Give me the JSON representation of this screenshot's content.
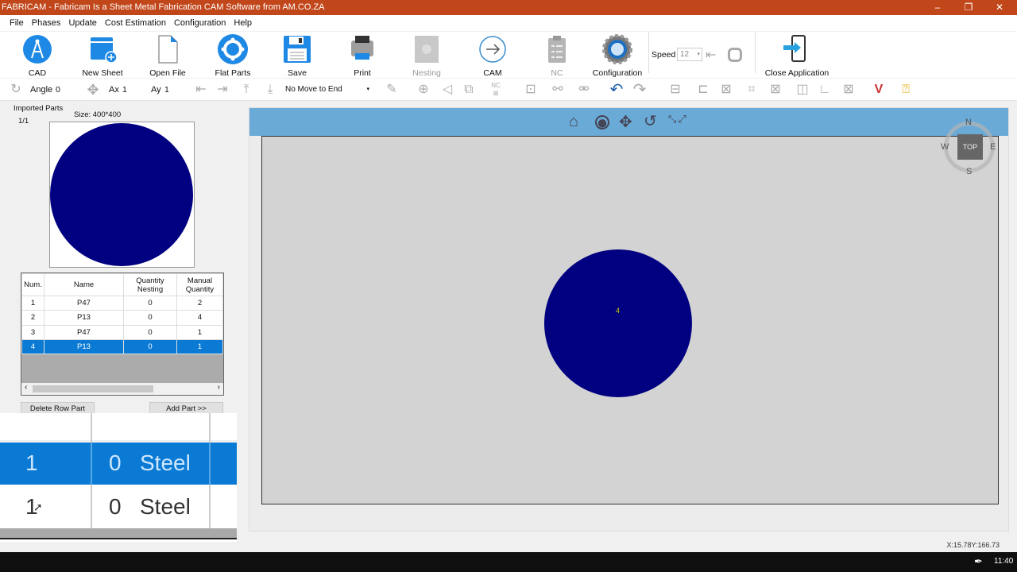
{
  "window": {
    "title": "FABRICAM - Fabricam Is a Sheet Metal Fabrication CAM Software from AM.CO.ZA",
    "minimize": "–",
    "restore": "❐",
    "close": "✕"
  },
  "menu": [
    "File",
    "Phases",
    "Update",
    "Cost Estimation",
    "Configuration",
    "Help"
  ],
  "toolbar": {
    "cad": "CAD",
    "new_sheet": "New Sheet",
    "open_file": "Open File",
    "flat_parts": "Flat Parts",
    "save": "Save",
    "print": "Print",
    "nesting": "Nesting",
    "cam": "CAM",
    "nc": "NC",
    "configuration": "Configuration",
    "speed_label": "Speed",
    "speed_value": "12",
    "close_app": "Close Application"
  },
  "toolbar2": {
    "angle_label": "Angle",
    "angle_value": "0",
    "ax_label": "Ax",
    "ax_value": "1",
    "ay_label": "Ay",
    "ay_value": "1",
    "move_select": "No Move to End",
    "nc_icon_text": "NC"
  },
  "imported_parts": {
    "title": "Imported Parts",
    "page": "1/1",
    "size": "Size: 400*400",
    "part_color": "#000080"
  },
  "parts_table": {
    "headers": [
      "Num.",
      "Name",
      "Quantity Nesting",
      "Manual Quantity"
    ],
    "rows": [
      [
        "1",
        "P47",
        "0",
        "2"
      ],
      [
        "2",
        "P13",
        "0",
        "4"
      ],
      [
        "3",
        "P47",
        "0",
        "1"
      ],
      [
        "4",
        "P13",
        "0",
        "1"
      ]
    ],
    "selected_row": 4
  },
  "buttons": {
    "delete_row": "Delete Row Part",
    "add_part": "Add Part >>"
  },
  "zoom_overlay": {
    "rows": [
      [
        "1",
        "0",
        "Steel"
      ],
      [
        "1",
        "0",
        "Steel"
      ]
    ]
  },
  "viewport": {
    "compass": {
      "n": "N",
      "s": "S",
      "e": "E",
      "w": "W",
      "top": "TOP"
    },
    "marker": "4"
  },
  "status": {
    "coords": "X:15.78Y:166.73"
  },
  "taskbar": {
    "time": "11:40"
  },
  "colors": {
    "titlebar": "#c1471b",
    "accent": "#0a7ad4",
    "viewport_header": "#6aaad6"
  }
}
